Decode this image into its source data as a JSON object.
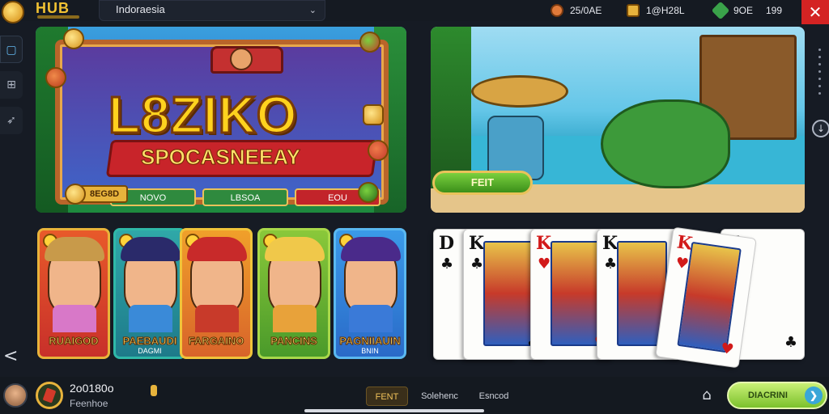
{
  "header": {
    "logo_text": "HUB",
    "country_select": {
      "value": "Indoraesia"
    },
    "currencies": [
      {
        "value": "25/0AE",
        "icon": "coin-icon",
        "color": "#e07a3a"
      },
      {
        "value": "1@H28L",
        "icon": "chest-icon",
        "color": "#e7b33c"
      },
      {
        "value": "9OE",
        "icon": "gem-icon",
        "color": "#3aa24a"
      },
      {
        "value": "199",
        "icon": "",
        "color": ""
      }
    ],
    "close_label": "✕"
  },
  "left_rail": {
    "items": [
      {
        "icon": "home-icon",
        "glyph": "▢"
      },
      {
        "icon": "gift-icon",
        "glyph": "⊞"
      },
      {
        "icon": "rocket-icon",
        "glyph": "➶"
      }
    ],
    "back_label": "<"
  },
  "banner_left": {
    "title": "L8ZIKO",
    "subtitle": "SPOCASNEEAY",
    "buttons": [
      "NOVO",
      "LBSOA",
      "EOU"
    ],
    "tag": "8EG8D"
  },
  "banner_right": {
    "start_label": "FEIT"
  },
  "character_cards": [
    {
      "label": "RUAIGOD",
      "sublabel": "",
      "colors": {
        "bg": "#e85a2a",
        "bg2": "#c8302a",
        "hair": "#c89a4a",
        "body": "#d878c8",
        "border": "#e9b33a"
      }
    },
    {
      "label": "PAEBAUDI",
      "sublabel": "DAGMI",
      "colors": {
        "bg": "#2fa8a8",
        "bg2": "#1e7a8a",
        "hair": "#2a2a6a",
        "body": "#3a8ad8",
        "border": "#2fb8a8"
      }
    },
    {
      "label": "FARGAINO",
      "sublabel": "",
      "colors": {
        "bg": "#f0a02a",
        "bg2": "#d8642a",
        "hair": "#c82a2a",
        "body": "#c83a2a",
        "border": "#f0c43a"
      }
    },
    {
      "label": "PANCINS",
      "sublabel": "",
      "colors": {
        "bg": "#8ac83a",
        "bg2": "#4a9a2a",
        "hair": "#f0c84a",
        "body": "#e8a23a",
        "border": "#a8d84a"
      }
    },
    {
      "label": "PAGNIIAUIN",
      "sublabel": "BNIN",
      "colors": {
        "bg": "#3a9ae8",
        "bg2": "#2a6ac8",
        "hair": "#4a2a8a",
        "body": "#3a7ad8",
        "border": "#5ab8f0"
      }
    }
  ],
  "playing_cards": [
    {
      "rank": "D",
      "suit": "♣",
      "color": "black"
    },
    {
      "rank": "K",
      "suit": "♣",
      "color": "black"
    },
    {
      "rank": "K",
      "suit": "♥",
      "color": "red"
    },
    {
      "rank": "K",
      "suit": "♣",
      "color": "black"
    },
    {
      "rank": "K",
      "suit": "♥",
      "color": "red"
    },
    {
      "rank": "Y",
      "suit": "♣",
      "color": "black"
    }
  ],
  "bottom_bar": {
    "balance": "2o0180o",
    "balance_label": "Feenhoe",
    "tabs": [
      {
        "label": "FENT",
        "active": true
      },
      {
        "label": "Solehenc",
        "active": false
      },
      {
        "label": "Esncod",
        "active": false
      }
    ],
    "cta_label": "DIACRINI"
  }
}
